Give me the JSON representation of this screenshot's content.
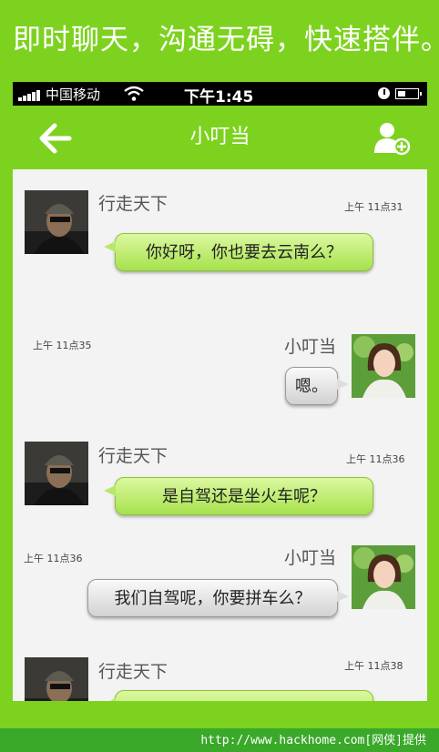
{
  "promo_banner": {
    "text": "即时聊天，沟通无碍，快速搭伴。"
  },
  "status_bar": {
    "carrier": "中国移动",
    "time": "下午1:45"
  },
  "nav": {
    "title": "小叮当"
  },
  "messages": [
    {
      "sender": "行走天下",
      "time": "上午 11点31",
      "text": "你好呀，你也要去云南么？",
      "side": "left"
    },
    {
      "sender": "小叮当",
      "time": "上午 11点35",
      "text": "嗯。",
      "side": "right"
    },
    {
      "sender": "行走天下",
      "time": "上午 11点36",
      "text": "是自驾还是坐火车呢？",
      "side": "left"
    },
    {
      "sender": "小叮当",
      "time": "上午 11点36",
      "text": "我们自驾呢，你要拼车么？",
      "side": "right"
    },
    {
      "sender": "行走天下",
      "time": "上午 11点38",
      "text": "",
      "side": "left"
    }
  ],
  "watermark": {
    "text": "http://www.hackhome.com[网侠]提供"
  },
  "colors": {
    "accent": "#7dd21f",
    "footer": "#3aa92a",
    "bubble_green": "#b8e86a",
    "bubble_gray": "#dedede",
    "chat_bg": "#f3f3f3"
  },
  "icons": {
    "back": "arrow-left-icon",
    "add_contact": "add-user-icon",
    "signal": "signal-bars-icon",
    "wifi": "wifi-icon",
    "clock": "clock-icon",
    "battery": "battery-icon"
  }
}
